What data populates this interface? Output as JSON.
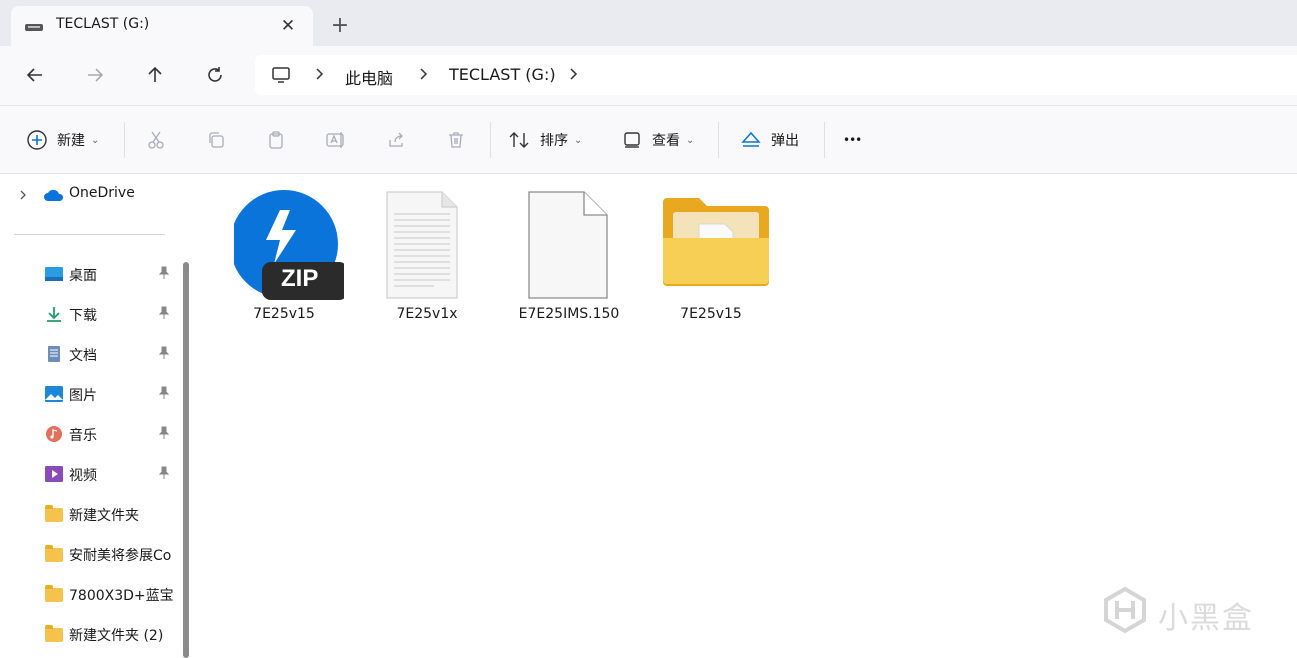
{
  "window": {
    "tab_title": "TECLAST (G:)",
    "tab_close": "✕",
    "new_tab": "+"
  },
  "navigation": {
    "breadcrumb": [
      "此电脑",
      "TECLAST (G:)"
    ]
  },
  "command_bar": {
    "new_label": "新建",
    "sort_label": "排序",
    "view_label": "查看",
    "eject_label": "弹出",
    "more_label": "•••"
  },
  "sidebar": {
    "onedrive": "OneDrive",
    "items": [
      {
        "label": "桌面",
        "pinned": true,
        "icon": "desktop-icon"
      },
      {
        "label": "下载",
        "pinned": true,
        "icon": "download-icon"
      },
      {
        "label": "文档",
        "pinned": true,
        "icon": "document-icon"
      },
      {
        "label": "图片",
        "pinned": true,
        "icon": "pictures-icon"
      },
      {
        "label": "音乐",
        "pinned": true,
        "icon": "music-icon"
      },
      {
        "label": "视频",
        "pinned": true,
        "icon": "video-icon"
      },
      {
        "label": "新建文件夹",
        "pinned": false,
        "icon": "folder-icon"
      },
      {
        "label": "安耐美将参展Co",
        "pinned": false,
        "icon": "folder-icon"
      },
      {
        "label": "7800X3D+蓝宝",
        "pinned": false,
        "icon": "folder-icon"
      },
      {
        "label": "新建文件夹 (2)",
        "pinned": false,
        "icon": "folder-icon"
      }
    ]
  },
  "files": [
    {
      "name": "7E25v15",
      "type": "zip-archive",
      "badge": "ZIP"
    },
    {
      "name": "7E25v1x",
      "type": "text-document"
    },
    {
      "name": "E7E25IMS.150",
      "type": "generic-file"
    },
    {
      "name": "7E25v15",
      "type": "folder"
    }
  ],
  "watermark": {
    "text": "小黑盒"
  },
  "colors": {
    "accent": "#0a74da",
    "folder": "#f5c34b",
    "zip_blue": "#0a74da"
  }
}
